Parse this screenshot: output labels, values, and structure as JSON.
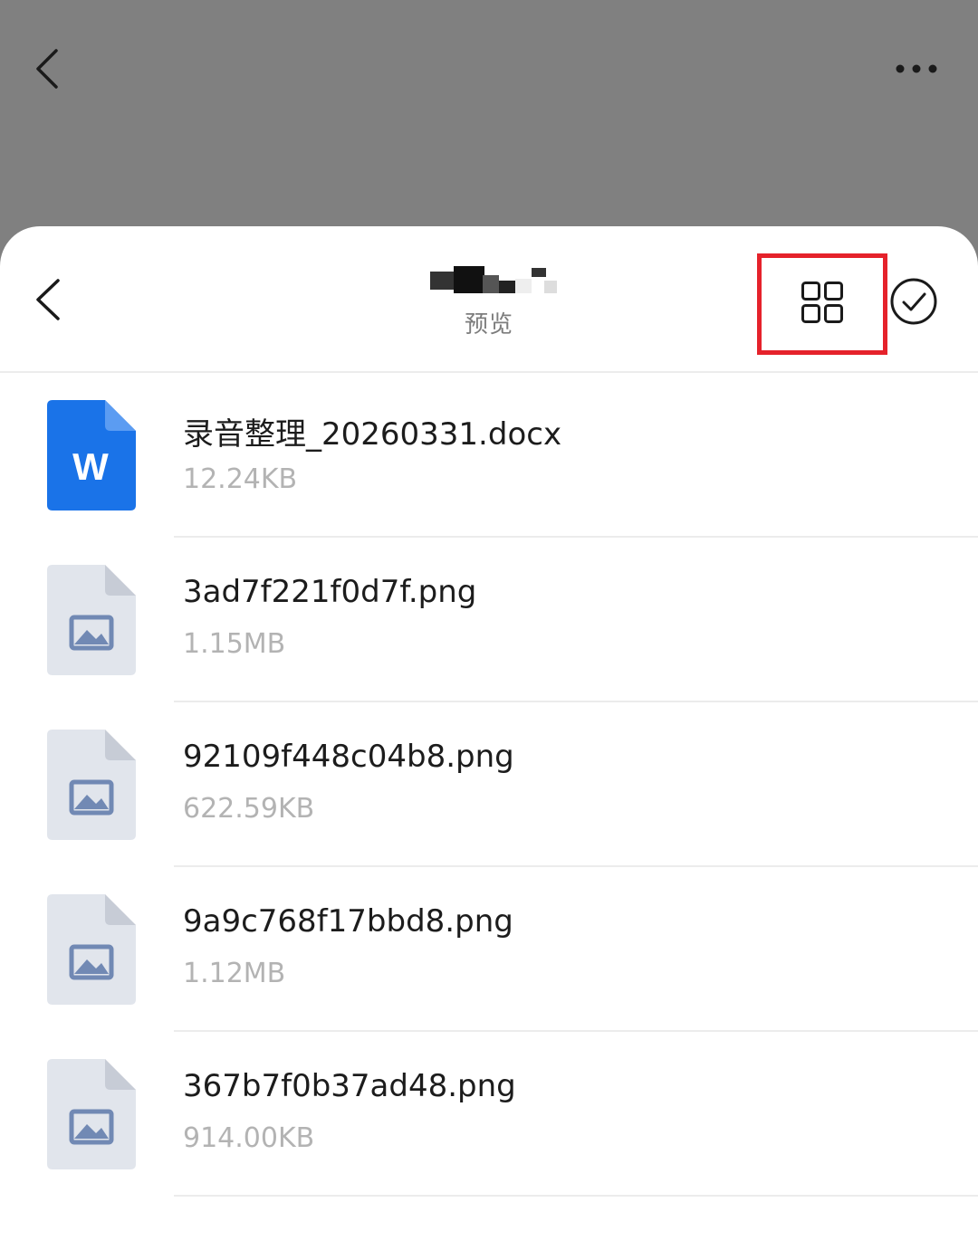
{
  "header": {
    "subtitle": "预览"
  },
  "colors": {
    "overlay": "#808080",
    "word_blue": "#1a73e8",
    "image_icon_bg": "#e1e5ec",
    "image_icon_glyph": "#7189b4",
    "highlight_red": "#e5222b"
  },
  "icons": {
    "top_back": "chevron-left-icon",
    "top_more": "more-horizontal-icon",
    "sheet_back": "chevron-left-icon",
    "grid_view": "grid-view-icon",
    "select": "check-circle-icon",
    "word_file": "word-file-icon",
    "image_file": "image-file-icon"
  },
  "files": [
    {
      "name": "录音整理_20260331.docx",
      "size": "12.24KB",
      "type": "docx",
      "icon_letter": "W"
    },
    {
      "name": "3ad7f221f0d7f.png",
      "size": "1.15MB",
      "type": "png"
    },
    {
      "name": "92109f448c04b8.png",
      "size": "622.59KB",
      "type": "png"
    },
    {
      "name": "9a9c768f17bbd8.png",
      "size": "1.12MB",
      "type": "png"
    },
    {
      "name": "367b7f0b37ad48.png",
      "size": "914.00KB",
      "type": "png"
    }
  ]
}
